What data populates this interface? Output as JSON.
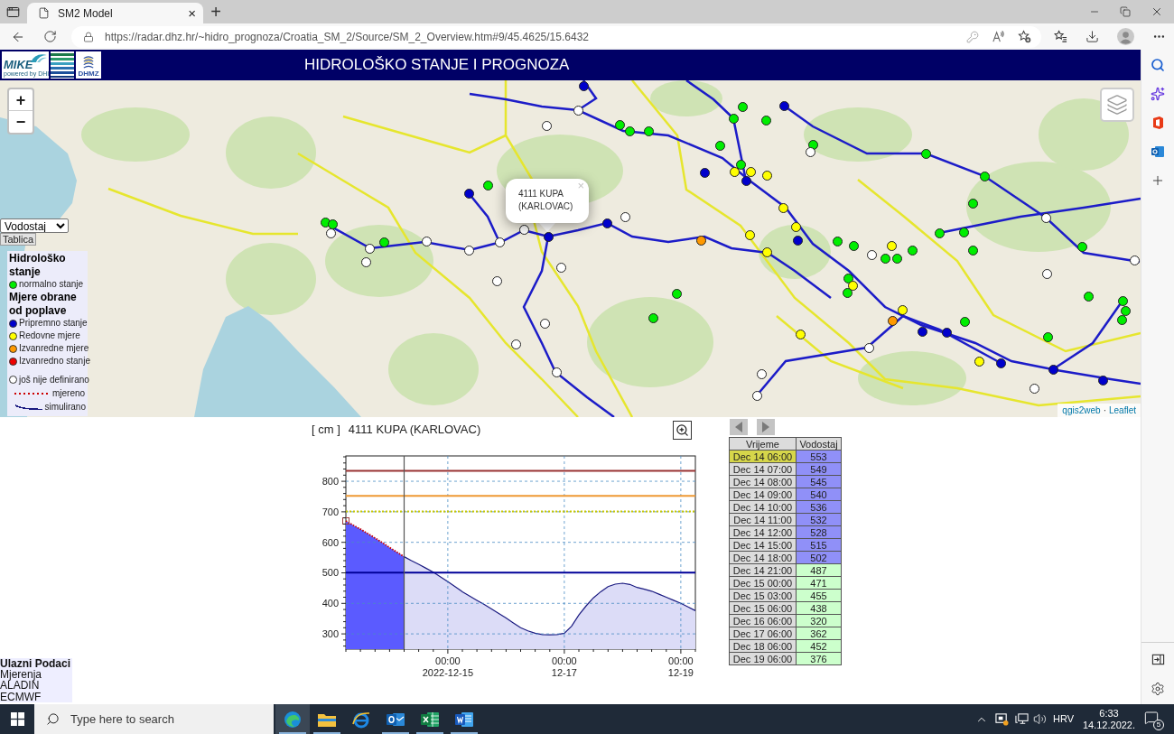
{
  "browser": {
    "tab_title": "SM2 Model",
    "tab_close": "×",
    "new_tab": "+",
    "url": "https://radar.dhz.hr/~hidro_prognoza/Croatia_SM_2/Source/SM_2_Overview.htm#9/45.4625/15.6432"
  },
  "header": {
    "logo_text": "MIKE",
    "logo_subtext": "powered by DHI",
    "logo2_text": "DHMZ",
    "title": "HIDROLOŠKO STANJE I PROGNOZA"
  },
  "map": {
    "zoom_in": "+",
    "zoom_out": "−",
    "popup": {
      "text": "4111 KUPA (KARLOVAC)",
      "close": "×"
    },
    "attribution": [
      {
        "kind": "link",
        "text": "qgis2web"
      },
      {
        "kind": "separator",
        "text": "·"
      },
      {
        "kind": "link",
        "text": "Leaflet"
      }
    ],
    "markers": [
      {
        "color": "#0000cc"
      },
      {
        "color": "#ffffff"
      },
      {
        "color": "#ffffff"
      },
      {
        "color": "#00ee00"
      },
      {
        "color": "#00ee00"
      },
      {
        "color": "#00ee00"
      },
      {
        "color": "#00ee00"
      },
      {
        "color": "#00ee00"
      },
      {
        "color": "#00ee00"
      },
      {
        "color": "#0000cc"
      },
      {
        "color": "#00ee00"
      },
      {
        "color": "#00ee00"
      },
      {
        "color": "#ffffff"
      },
      {
        "color": "#00ee00"
      },
      {
        "color": "#0000cc"
      },
      {
        "color": "#ffff00"
      },
      {
        "color": "#00ee00"
      },
      {
        "color": "#ffff00"
      },
      {
        "color": "#ffff00"
      },
      {
        "color": "#0000cc"
      },
      {
        "color": "#00ee00"
      },
      {
        "color": "#00ee00"
      },
      {
        "color": "#0000cc"
      },
      {
        "color": "#00ee00"
      },
      {
        "color": "#ffff00"
      },
      {
        "color": "#ffffff"
      },
      {
        "color": "#ffffff"
      },
      {
        "color": "#0000cc"
      },
      {
        "color": "#00ee00"
      },
      {
        "color": "#00ee00"
      },
      {
        "color": "#ffff00"
      },
      {
        "color": "#00ee00"
      },
      {
        "color": "#00ee00"
      },
      {
        "color": "#ffffff"
      },
      {
        "color": "#ffffff"
      },
      {
        "color": "#0000cc"
      },
      {
        "color": "#ffff00"
      },
      {
        "color": "#0000cc"
      },
      {
        "color": "#ff9900"
      },
      {
        "color": "#ffffff"
      },
      {
        "color": "#ffffff"
      },
      {
        "color": "#00ee00"
      },
      {
        "color": "#00ee00"
      },
      {
        "color": "#00ee00"
      },
      {
        "color": "#ffff00"
      },
      {
        "color": "#00ee00"
      },
      {
        "color": "#ffffff"
      },
      {
        "color": "#ffffff"
      },
      {
        "color": "#ffff00"
      },
      {
        "color": "#00ee00"
      },
      {
        "color": "#00ee00"
      },
      {
        "color": "#ffffff"
      },
      {
        "color": "#00ee00"
      },
      {
        "color": "#00ee00"
      },
      {
        "color": "#ffffff"
      },
      {
        "color": "#ffffff"
      },
      {
        "color": "#ffffff"
      },
      {
        "color": "#ffffff"
      },
      {
        "color": "#ffffff"
      },
      {
        "color": "#00ee00"
      },
      {
        "color": "#ffff00"
      },
      {
        "color": "#00ee00"
      },
      {
        "color": "#00ee00"
      },
      {
        "color": "#00ee00"
      },
      {
        "color": "#00ee00"
      },
      {
        "color": "#00ee00"
      },
      {
        "color": "#00ee00"
      },
      {
        "color": "#ff9900"
      },
      {
        "color": "#ffff00"
      },
      {
        "color": "#00ee00"
      },
      {
        "color": "#00ee00"
      },
      {
        "color": "#ffffff"
      },
      {
        "color": "#0000cc"
      },
      {
        "color": "#0000cc"
      },
      {
        "color": "#ffff00"
      },
      {
        "color": "#00ee00"
      },
      {
        "color": "#ffffff"
      },
      {
        "color": "#ffffff"
      },
      {
        "color": "#ffff00"
      },
      {
        "color": "#0000cc"
      },
      {
        "color": "#0000cc"
      },
      {
        "color": "#ffffff"
      },
      {
        "color": "#ffffff"
      },
      {
        "color": "#0000cc"
      },
      {
        "color": "#ffffff"
      },
      {
        "color": "#ffffff"
      }
    ]
  },
  "controls": {
    "parameter": "Vodostaj",
    "table_button": "Tablica"
  },
  "legend": {
    "groups": [
      {
        "title": "Hidrološko stanje",
        "items": [
          {
            "label": "normalno stanje",
            "color": "#00ee00"
          }
        ]
      },
      {
        "title": "Mjere obrane od poplave",
        "items": [
          {
            "label": "Pripremno stanje",
            "color": "#0000cc"
          },
          {
            "label": "Redovne mjere",
            "color": "#ffff00"
          },
          {
            "label": "Izvanredne mjere",
            "color": "#ff9900"
          },
          {
            "label": "Izvanredno stanje",
            "color": "#ee0000"
          }
        ]
      }
    ],
    "extras": [
      {
        "kind": "dot",
        "label": "još nije definirano",
        "color": "#ffffff"
      },
      {
        "kind": "dotted-line",
        "label": "mjereno",
        "color": "#cc0000"
      },
      {
        "kind": "line",
        "label": "simulirano",
        "color": "#1a1a80"
      }
    ]
  },
  "chart": {
    "chart_data": {
      "type": "area",
      "title": "4111 KUPA (KARLOVAC)",
      "ylabel": "[ cm ]",
      "categories": [
        null,
        null,
        null,
        null,
        null,
        null,
        null,
        null,
        null,
        null,
        null,
        null,
        null,
        null,
        "00:00 2022-12-15",
        null,
        null,
        null,
        null,
        null,
        null,
        null,
        null,
        null,
        null,
        null,
        null,
        null,
        null,
        null,
        "00:00 12-17",
        null,
        null,
        null,
        null,
        null,
        null,
        null,
        null,
        null,
        null,
        null,
        null,
        null,
        null,
        null,
        "00:00 12-19",
        null,
        null
      ],
      "series": [
        {
          "color": "#5b5bff",
          "values": [
            670,
            656,
            643,
            629,
            614,
            599,
            583,
            568,
            553,
            null,
            null,
            null,
            null,
            null,
            null,
            null,
            null,
            null,
            null,
            null,
            null,
            null,
            null,
            null,
            null,
            null,
            null,
            null,
            null,
            null,
            null,
            null,
            null,
            null,
            null,
            null,
            null,
            null,
            null,
            null,
            null,
            null,
            null,
            null,
            null,
            null,
            null,
            null,
            null
          ]
        },
        {
          "type": "line",
          "line_style": "dotted",
          "color": "#cc0000",
          "values": [
            670,
            656,
            643,
            629,
            614,
            599,
            583,
            568,
            553,
            null,
            null,
            null,
            null,
            null,
            null,
            null,
            null,
            null,
            null,
            null,
            null,
            null,
            null,
            null,
            null,
            null,
            null,
            null,
            null,
            null,
            null,
            null,
            null,
            null,
            null,
            null,
            null,
            null,
            null,
            null,
            null,
            null,
            null,
            null,
            null,
            null,
            null,
            null,
            null
          ]
        },
        {
          "color": "#1a1a80",
          "values": [
            null,
            null,
            null,
            null,
            null,
            null,
            null,
            null,
            553,
            540,
            528,
            515,
            502,
            487,
            471,
            455,
            438,
            424,
            410,
            396,
            382,
            367,
            352,
            336,
            320,
            310,
            302,
            298,
            297,
            298,
            302,
            325,
            362,
            392,
            418,
            438,
            455,
            463,
            466,
            462,
            452,
            446,
            440,
            430,
            420,
            410,
            400,
            388,
            376
          ]
        }
      ],
      "ylim": [
        250,
        883
      ],
      "yticks": [
        300,
        400,
        500,
        600,
        700,
        800
      ],
      "grid": true,
      "ref_lines": [
        {
          "axis": "y",
          "value": 834,
          "color": "#993333"
        },
        {
          "axis": "y",
          "value": 752,
          "color": "#ee9933"
        },
        {
          "axis": "y",
          "value": 701,
          "color": "#c8c800"
        },
        {
          "axis": "y",
          "value": 501,
          "color": "#000099"
        }
      ]
    }
  },
  "table": {
    "columns": [
      "Vrijeme",
      "Vodostaj"
    ],
    "rows": [
      {
        "time": "Dec 14 06:00",
        "value": "553",
        "selected": true,
        "color": "#9090f8"
      },
      {
        "time": "Dec 14 07:00",
        "value": "549",
        "selected": false,
        "color": "#9090f8"
      },
      {
        "time": "Dec 14 08:00",
        "value": "545",
        "selected": false,
        "color": "#9090f8"
      },
      {
        "time": "Dec 14 09:00",
        "value": "540",
        "selected": false,
        "color": "#9090f8"
      },
      {
        "time": "Dec 14 10:00",
        "value": "536",
        "selected": false,
        "color": "#9090f8"
      },
      {
        "time": "Dec 14 11:00",
        "value": "532",
        "selected": false,
        "color": "#9090f8"
      },
      {
        "time": "Dec 14 12:00",
        "value": "528",
        "selected": false,
        "color": "#9090f8"
      },
      {
        "time": "Dec 14 15:00",
        "value": "515",
        "selected": false,
        "color": "#9090f8"
      },
      {
        "time": "Dec 14 18:00",
        "value": "502",
        "selected": false,
        "color": "#9090f8"
      },
      {
        "time": "Dec 14 21:00",
        "value": "487",
        "selected": false,
        "color": "#ccffcc"
      },
      {
        "time": "Dec 15 00:00",
        "value": "471",
        "selected": false,
        "color": "#ccffcc"
      },
      {
        "time": "Dec 15 03:00",
        "value": "455",
        "selected": false,
        "color": "#ccffcc"
      },
      {
        "time": "Dec 15 06:00",
        "value": "438",
        "selected": false,
        "color": "#ccffcc"
      },
      {
        "time": "Dec 16 06:00",
        "value": "320",
        "selected": false,
        "color": "#ccffcc"
      },
      {
        "time": "Dec 17 06:00",
        "value": "362",
        "selected": false,
        "color": "#ccffcc"
      },
      {
        "time": "Dec 18 06:00",
        "value": "452",
        "selected": false,
        "color": "#ccffcc"
      },
      {
        "time": "Dec 19 06:00",
        "value": "376",
        "selected": false,
        "color": "#ccffcc"
      }
    ]
  },
  "inputs": {
    "title": "Ulazni Podaci",
    "items": [
      "Mjerenja",
      "ALADIN",
      "ECMWF"
    ]
  },
  "taskbar": {
    "search_placeholder": "Type here to search",
    "apps": [
      {
        "kind": "edge",
        "selected": true,
        "running": true
      },
      {
        "kind": "explorer",
        "selected": false,
        "running": true
      },
      {
        "kind": "ie",
        "selected": false,
        "running": false
      },
      {
        "kind": "outlook",
        "selected": false,
        "running": true
      },
      {
        "kind": "excel",
        "selected": false,
        "running": true
      },
      {
        "kind": "word",
        "selected": false,
        "running": true
      }
    ],
    "language": "HRV",
    "time": "6:33",
    "date": "14.12.2022.",
    "notifications": "5"
  }
}
